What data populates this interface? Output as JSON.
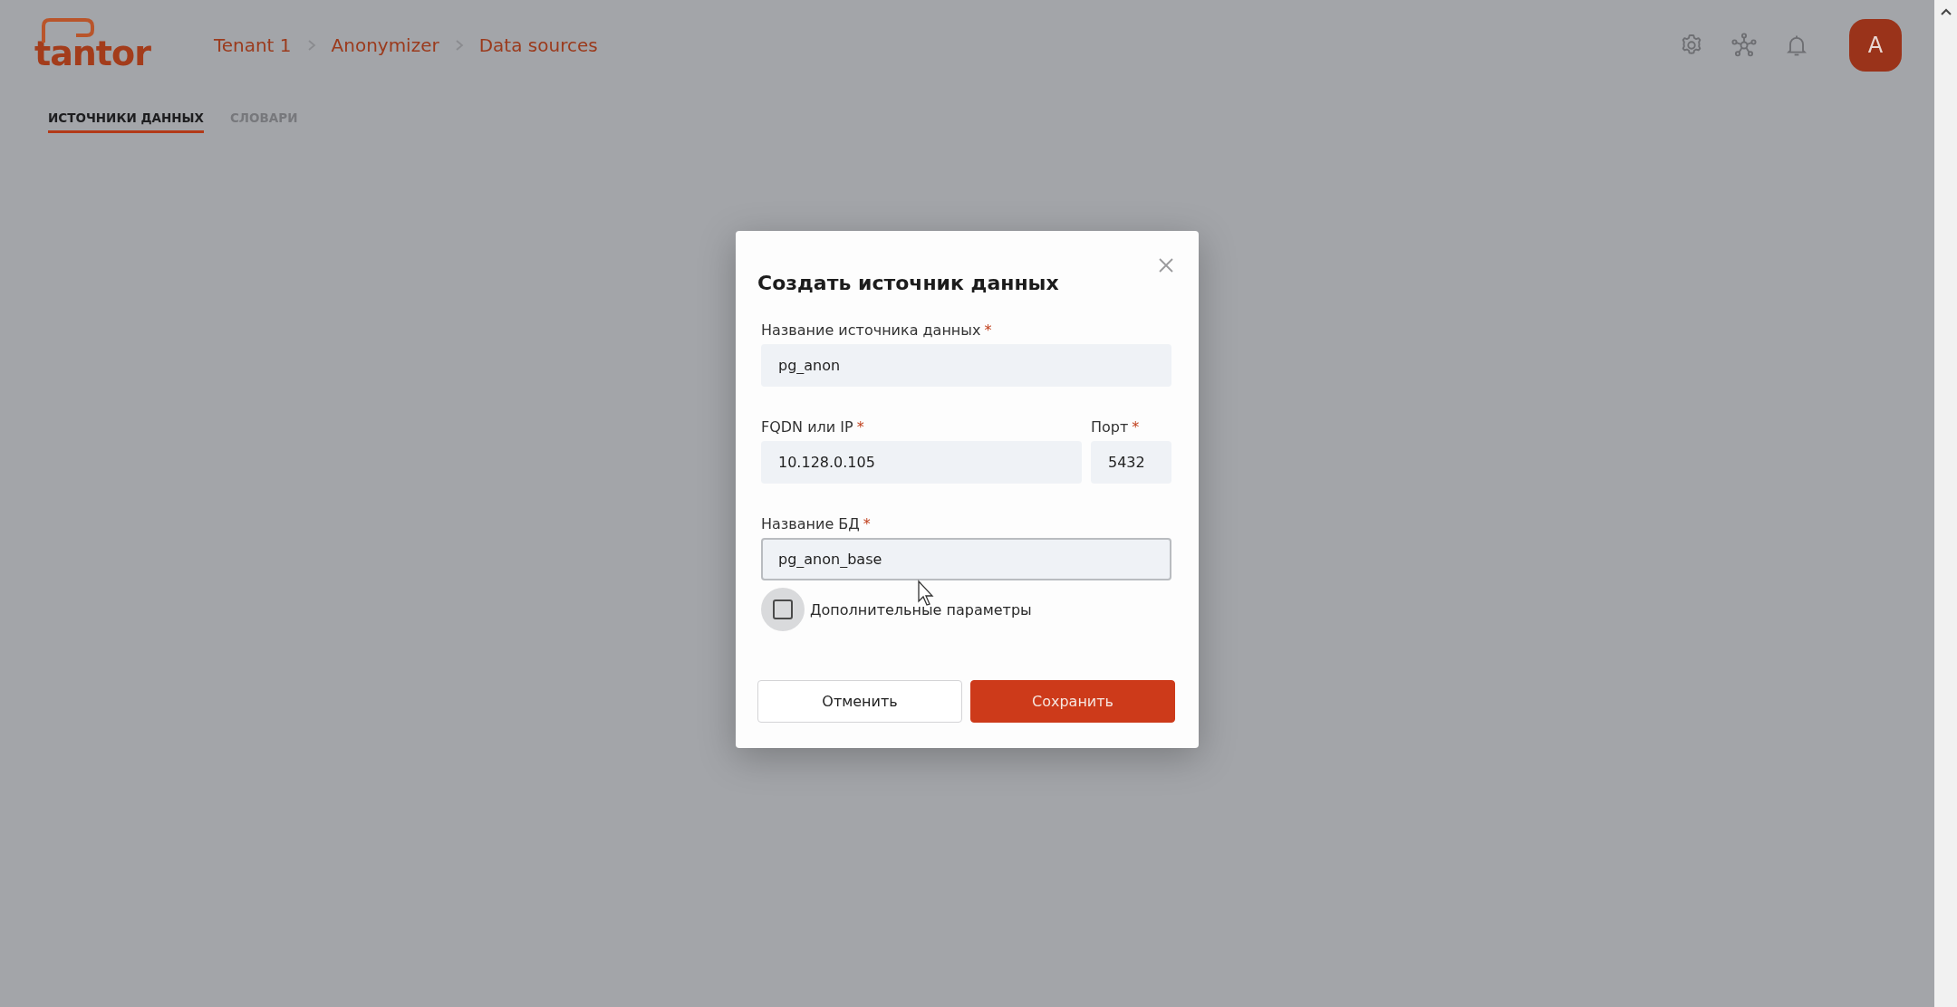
{
  "header": {
    "logo": "tantor",
    "breadcrumbs": [
      "Tenant 1",
      "Anonymizer",
      "Data sources"
    ],
    "avatar": "A"
  },
  "tabs": [
    {
      "label": "ИСТОЧНИКИ ДАННЫХ",
      "selected": true
    },
    {
      "label": "СЛОВАРИ",
      "selected": false
    }
  ],
  "dialog": {
    "title": "Создать источник данных",
    "rows": [
      [
        {
          "label": "Название источника данных",
          "required_mark": "*",
          "value": "pg_anon",
          "focused": false
        }
      ],
      [
        {
          "label": "FQDN или IP",
          "required_mark": "*",
          "value": "10.128.0.105",
          "focused": false
        },
        {
          "label": "Порт",
          "required_mark": "*",
          "value": "5432",
          "focused": false
        }
      ],
      [
        {
          "label": "Название БД",
          "required_mark": "*",
          "value": "pg_anon_base",
          "focused": true
        }
      ]
    ],
    "checkbox": {
      "label": "Дополнительные параметры",
      "checked": false
    },
    "buttons": [
      {
        "label": "Отменить",
        "kind": "secondary"
      },
      {
        "label": "Сохранить",
        "kind": "primary"
      }
    ]
  }
}
